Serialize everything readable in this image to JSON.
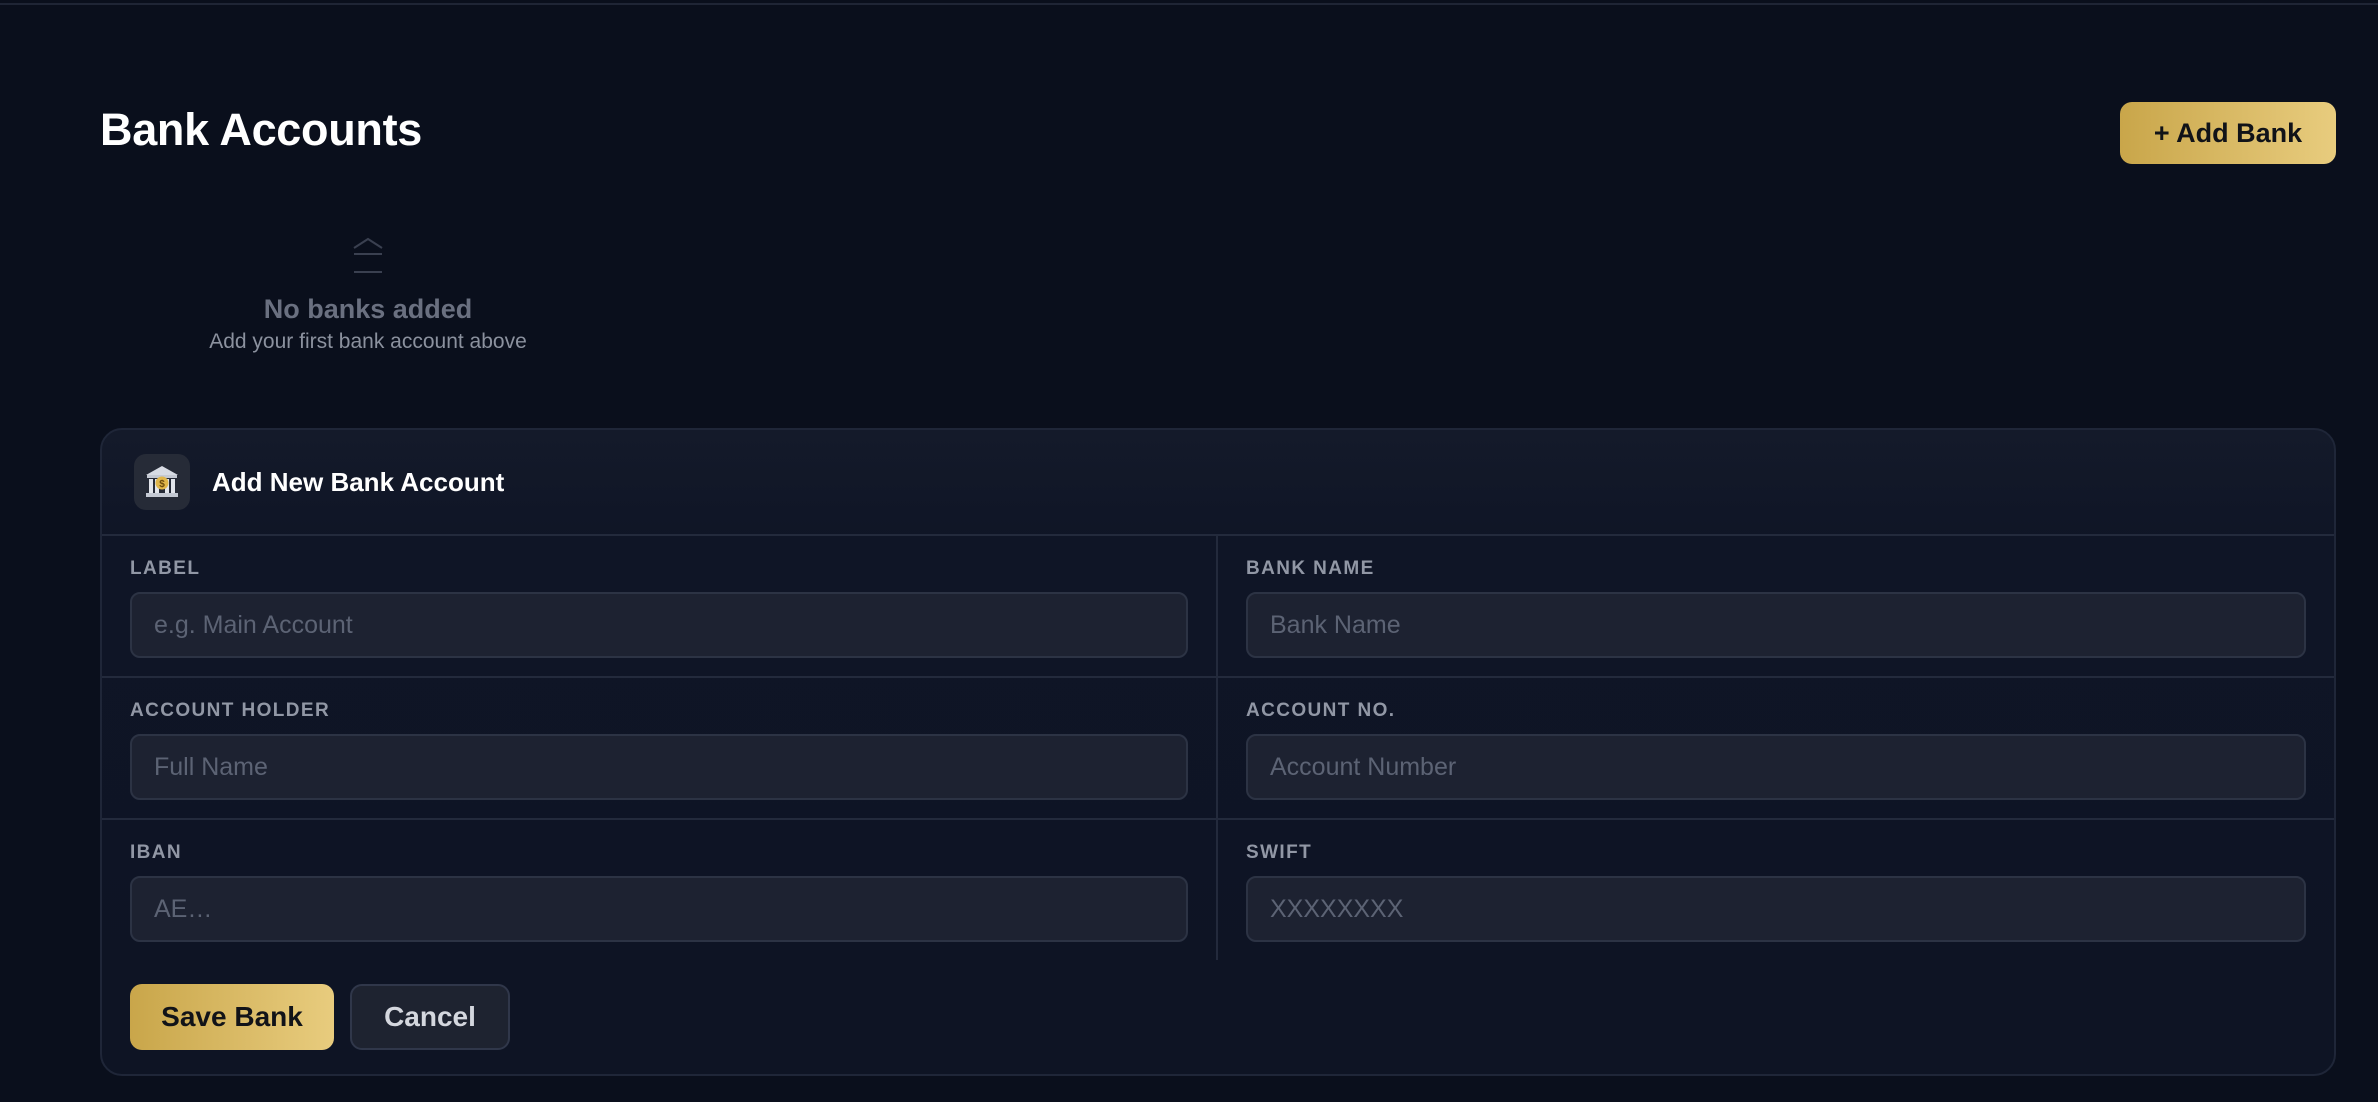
{
  "header": {
    "title": "Bank Accounts",
    "add_button_label": "+ Add Bank"
  },
  "empty_state": {
    "icon": "bank-outline-icon",
    "title": "No banks added",
    "subtitle": "Add your first bank account above"
  },
  "form": {
    "icon": "bank-icon",
    "title": "Add New Bank Account",
    "fields": {
      "label": {
        "label": "LABEL",
        "placeholder": "e.g. Main Account",
        "value": ""
      },
      "bank_name": {
        "label": "BANK NAME",
        "placeholder": "Bank Name",
        "value": ""
      },
      "account_holder": {
        "label": "ACCOUNT HOLDER",
        "placeholder": "Full Name",
        "value": ""
      },
      "account_no": {
        "label": "ACCOUNT NO.",
        "placeholder": "Account Number",
        "value": ""
      },
      "iban": {
        "label": "IBAN",
        "placeholder": "AE…",
        "value": ""
      },
      "swift": {
        "label": "SWIFT",
        "placeholder": "XXXXXXXX",
        "value": ""
      }
    },
    "save_label": "Save Bank",
    "cancel_label": "Cancel"
  },
  "colors": {
    "background": "#0a0f1c",
    "accent_gold_start": "#c9a64a",
    "accent_gold_end": "#e8cc7e",
    "card_border": "#1f2638",
    "input_bg": "#1d2231"
  }
}
